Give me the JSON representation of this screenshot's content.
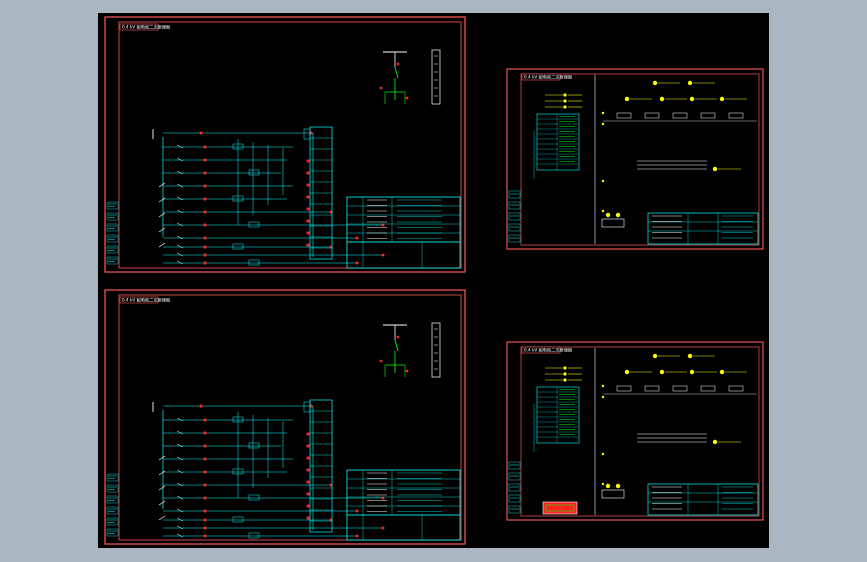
{
  "colors": {
    "background": "#aab6c2",
    "canvas": "#000000",
    "frame": "#ff5a5a",
    "wire": "#00ffff",
    "terminal": "#ff2020",
    "note": "#ffff00",
    "text": "#ffffff",
    "switch": "#00ff00",
    "stamp_fill": "#ff2020",
    "stamp_text": "#00ff00"
  },
  "sheets": [
    {
      "id": "sheet-1",
      "kind": "control-circuit",
      "tag": "0.4 kV 配电柜二次原理图"
    },
    {
      "id": "sheet-2",
      "kind": "wiring-layout",
      "tag": "0.4 kV 配电柜二次原理图"
    },
    {
      "id": "sheet-3",
      "kind": "control-circuit",
      "tag": "0.4 kV 配电柜二次原理图"
    },
    {
      "id": "sheet-4",
      "kind": "wiring-layout",
      "tag": "0.4 kV 配电柜二次原理图"
    }
  ],
  "stamp": {
    "text": "—"
  }
}
